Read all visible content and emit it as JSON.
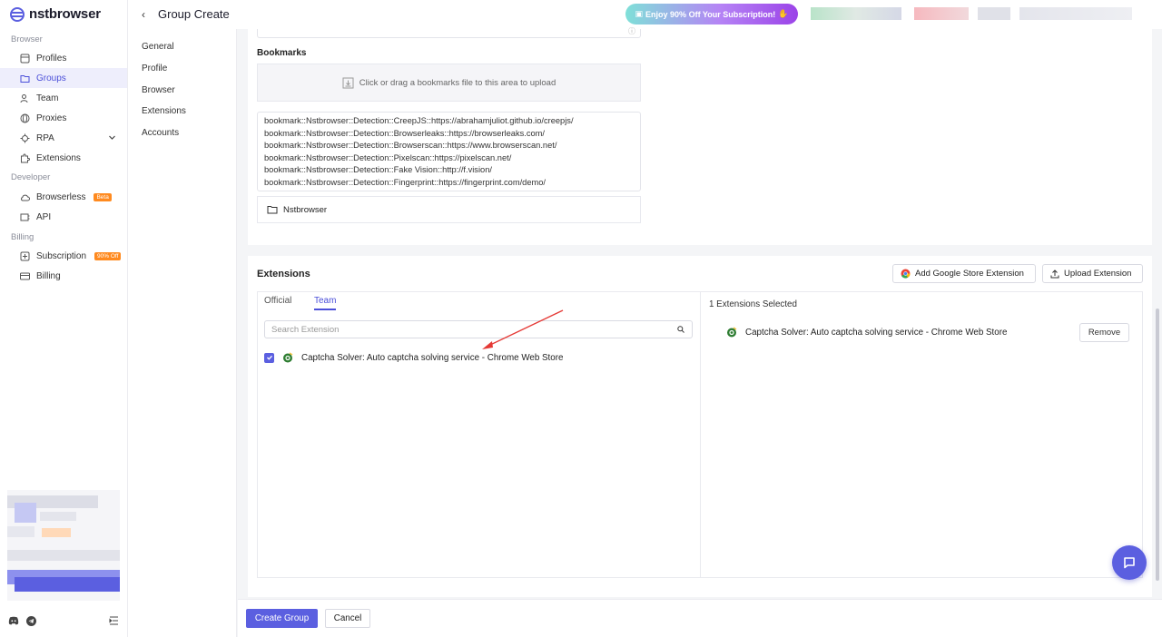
{
  "app": {
    "name": "nstbrowser"
  },
  "header": {
    "title": "Group Create",
    "promo": "Enjoy 90% Off Your Subscription!"
  },
  "sidebar": {
    "sections": [
      {
        "label": "Browser",
        "items": [
          {
            "label": "Profiles",
            "icon": "profiles-icon"
          },
          {
            "label": "Groups",
            "icon": "folder-icon",
            "active": true
          },
          {
            "label": "Team",
            "icon": "team-icon"
          },
          {
            "label": "Proxies",
            "icon": "globe-icon"
          },
          {
            "label": "RPA",
            "icon": "rpa-icon"
          },
          {
            "label": "Extensions",
            "icon": "puzzle-icon"
          }
        ]
      },
      {
        "label": "Developer",
        "items": [
          {
            "label": "Browserless",
            "icon": "cloud-icon",
            "badge": "Beta"
          },
          {
            "label": "API",
            "icon": "api-icon"
          }
        ]
      },
      {
        "label": "Billing",
        "items": [
          {
            "label": "Subscription",
            "icon": "plus-icon",
            "badge": "90% Off"
          },
          {
            "label": "Billing",
            "icon": "card-icon"
          }
        ]
      }
    ]
  },
  "subnav": {
    "items": [
      "General",
      "Profile",
      "Browser",
      "Extensions",
      "Accounts"
    ]
  },
  "bookmarks": {
    "label": "Bookmarks",
    "dropzone": "Click or drag a bookmarks file to this area to upload",
    "lines": [
      "bookmark::Nstbrowser::Detection::CreepJS::https://abrahamjuliot.github.io/creepjs/",
      "bookmark::Nstbrowser::Detection::Browserleaks::https://browserleaks.com/",
      "bookmark::Nstbrowser::Detection::Browserscan::https://www.browserscan.net/",
      "bookmark::Nstbrowser::Detection::Pixelscan::https://pixelscan.net/",
      "bookmark::Nstbrowser::Detection::Fake Vision::http://f.vision/",
      "bookmark::Nstbrowser::Detection::Fingerprint::https://fingerprint.com/demo/"
    ],
    "folder": "Nstbrowser"
  },
  "extensions": {
    "title": "Extensions",
    "add_google": "Add Google Store Extension",
    "upload": "Upload Extension",
    "tabs": [
      "Official",
      "Team"
    ],
    "search_placeholder": "Search Extension",
    "item": "Captcha Solver: Auto captcha solving service - Chrome Web Store",
    "selected_count": "1 Extensions Selected",
    "selected_item": "Captcha Solver: Auto captcha solving service - Chrome Web Store",
    "remove": "Remove"
  },
  "footer": {
    "create": "Create Group",
    "cancel": "Cancel"
  },
  "colors": {
    "accent": "#5b5fe0",
    "badge": "#ff8a1f",
    "arrow": "#e53935"
  }
}
